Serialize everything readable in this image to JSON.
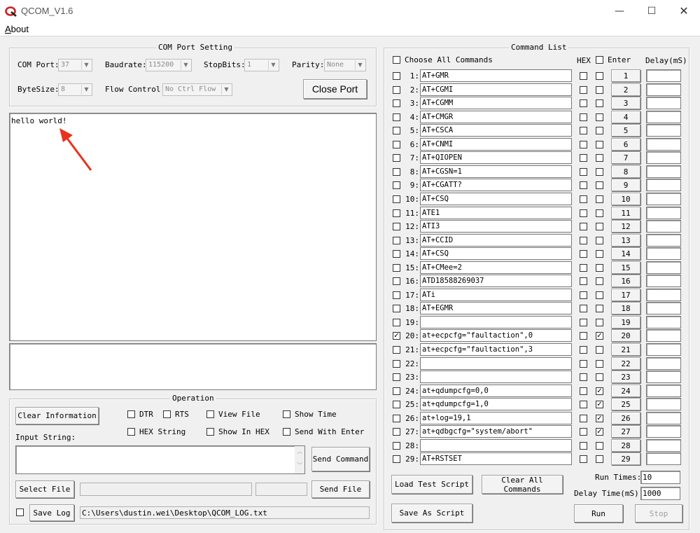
{
  "window": {
    "title": "QCOM_V1.6",
    "minimize": "—",
    "maximize": "☐",
    "close": "✕"
  },
  "menu": {
    "about": "About"
  },
  "com_port_setting": {
    "title": "COM Port Setting",
    "com_port_label": "COM Port:",
    "com_port_value": "37",
    "baudrate_label": "Baudrate:",
    "baudrate_value": "115200",
    "stopbits_label": "StopBits:",
    "stopbits_value": "1",
    "parity_label": "Parity:",
    "parity_value": "None",
    "bytesize_label": "ByteSize:",
    "bytesize_value": "8",
    "flow_control_label": "Flow Control:",
    "flow_control_value": "No Ctrl Flow",
    "close_port_label": "Close Port"
  },
  "receive_area": {
    "text": "hello world!"
  },
  "operation": {
    "title": "Operation",
    "clear_information": "Clear Information",
    "checkboxes": [
      {
        "label": "DTR",
        "checked": false
      },
      {
        "label": "RTS",
        "checked": false
      },
      {
        "label": "View File",
        "checked": false
      },
      {
        "label": "Show Time",
        "checked": false
      },
      {
        "label": "HEX String",
        "checked": false
      },
      {
        "label": "Show In HEX",
        "checked": false
      },
      {
        "label": "Send With Enter",
        "checked": false
      }
    ],
    "input_string_label": "Input String:",
    "input_string_value": "",
    "send_command": "Send Command",
    "select_file": "Select File",
    "send_file": "Send File",
    "save_log_button": "Save Log",
    "log_path": "C:\\Users\\dustin.wei\\Desktop\\QCOM_LOG.txt"
  },
  "command_list": {
    "title": "Command List",
    "choose_all": "Choose All Commands",
    "hex_header": "HEX",
    "enter_header": "Enter",
    "delay_header": "Delay(mS)",
    "rows": [
      {
        "num": "1:",
        "cmd": "AT+GMR",
        "checked": false,
        "hex": false,
        "enter": false,
        "btn": "1"
      },
      {
        "num": "2:",
        "cmd": "AT+CGMI",
        "checked": false,
        "hex": false,
        "enter": false,
        "btn": "2"
      },
      {
        "num": "3:",
        "cmd": "AT+CGMM",
        "checked": false,
        "hex": false,
        "enter": false,
        "btn": "3"
      },
      {
        "num": "4:",
        "cmd": "AT+CMGR",
        "checked": false,
        "hex": false,
        "enter": false,
        "btn": "4"
      },
      {
        "num": "5:",
        "cmd": "AT+CSCA",
        "checked": false,
        "hex": false,
        "enter": false,
        "btn": "5"
      },
      {
        "num": "6:",
        "cmd": "AT+CNMI",
        "checked": false,
        "hex": false,
        "enter": false,
        "btn": "6"
      },
      {
        "num": "7:",
        "cmd": "AT+QIOPEN",
        "checked": false,
        "hex": false,
        "enter": false,
        "btn": "7"
      },
      {
        "num": "8:",
        "cmd": "AT+CGSN=1",
        "checked": false,
        "hex": false,
        "enter": false,
        "btn": "8"
      },
      {
        "num": "9:",
        "cmd": "AT+CGATT?",
        "checked": false,
        "hex": false,
        "enter": false,
        "btn": "9"
      },
      {
        "num": "10:",
        "cmd": "AT+CSQ",
        "checked": false,
        "hex": false,
        "enter": false,
        "btn": "10"
      },
      {
        "num": "11:",
        "cmd": "ATE1",
        "checked": false,
        "hex": false,
        "enter": false,
        "btn": "11"
      },
      {
        "num": "12:",
        "cmd": "ATI3",
        "checked": false,
        "hex": false,
        "enter": false,
        "btn": "12"
      },
      {
        "num": "13:",
        "cmd": "AT+CCID",
        "checked": false,
        "hex": false,
        "enter": false,
        "btn": "13"
      },
      {
        "num": "14:",
        "cmd": "AT+CSQ",
        "checked": false,
        "hex": false,
        "enter": false,
        "btn": "14"
      },
      {
        "num": "15:",
        "cmd": "AT+CMee=2",
        "checked": false,
        "hex": false,
        "enter": false,
        "btn": "15"
      },
      {
        "num": "16:",
        "cmd": "ATD18588269037",
        "checked": false,
        "hex": false,
        "enter": false,
        "btn": "16"
      },
      {
        "num": "17:",
        "cmd": "ATi",
        "checked": false,
        "hex": false,
        "enter": false,
        "btn": "17"
      },
      {
        "num": "18:",
        "cmd": "AT+EGMR",
        "checked": false,
        "hex": false,
        "enter": false,
        "btn": "18"
      },
      {
        "num": "19:",
        "cmd": "",
        "checked": false,
        "hex": false,
        "enter": false,
        "btn": "19"
      },
      {
        "num": "20:",
        "cmd": "at+ecpcfg=\"faultaction\",0",
        "checked": true,
        "hex": false,
        "enter": true,
        "btn": "20"
      },
      {
        "num": "21:",
        "cmd": "at+ecpcfg=\"faultaction\",3",
        "checked": false,
        "hex": false,
        "enter": false,
        "btn": "21"
      },
      {
        "num": "22:",
        "cmd": "",
        "checked": false,
        "hex": false,
        "enter": false,
        "btn": "22"
      },
      {
        "num": "23:",
        "cmd": "",
        "checked": false,
        "hex": false,
        "enter": false,
        "btn": "23"
      },
      {
        "num": "24:",
        "cmd": "at+qdumpcfg=0,0",
        "checked": false,
        "hex": false,
        "enter": true,
        "btn": "24"
      },
      {
        "num": "25:",
        "cmd": "at+qdumpcfg=1,0",
        "checked": false,
        "hex": false,
        "enter": true,
        "btn": "25"
      },
      {
        "num": "26:",
        "cmd": "at+log=19,1",
        "checked": false,
        "hex": false,
        "enter": true,
        "btn": "26"
      },
      {
        "num": "27:",
        "cmd": "at+qdbgcfg=\"system/abort\"",
        "checked": false,
        "hex": false,
        "enter": true,
        "btn": "27"
      },
      {
        "num": "28:",
        "cmd": "",
        "checked": false,
        "hex": false,
        "enter": false,
        "btn": "28"
      },
      {
        "num": "29:",
        "cmd": "AT+RSTSET",
        "checked": false,
        "hex": false,
        "enter": false,
        "btn": "29"
      }
    ],
    "load_test_script": "Load Test Script",
    "clear_all_commands": "Clear All Commands",
    "save_as_script": "Save As Script",
    "run_times_label": "Run Times:",
    "run_times_value": "10",
    "delay_time_label": "Delay Time(mS):",
    "delay_time_value": "1000",
    "run": "Run",
    "stop": "Stop"
  },
  "colors": {
    "annotation_arrow": "#e8321e",
    "icon_red": "#d21f1f"
  },
  "icons": {
    "checkmark": "check-icon",
    "dropdown": "chevron-down-icon"
  }
}
